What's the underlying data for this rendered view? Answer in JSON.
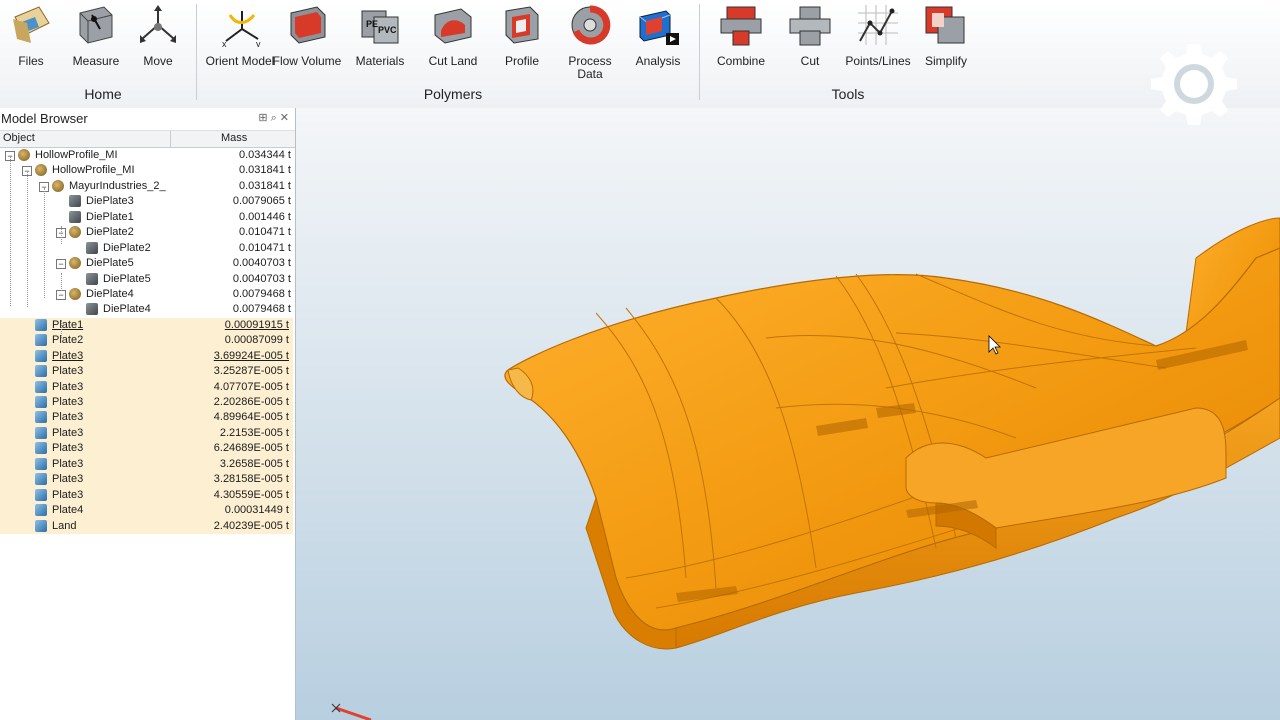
{
  "ribbon": {
    "buttons": [
      {
        "label": "Files",
        "icon": "files-icon"
      },
      {
        "label": "Measure",
        "icon": "measure-icon"
      },
      {
        "label": "Move",
        "icon": "move-icon"
      },
      {
        "label": "Orient Model",
        "icon": "orient-model-icon"
      },
      {
        "label": "Flow Volume",
        "icon": "flow-volume-icon"
      },
      {
        "label": "Materials",
        "icon": "materials-icon"
      },
      {
        "label": "Cut Land",
        "icon": "cut-land-icon"
      },
      {
        "label": "Profile",
        "icon": "profile-icon"
      },
      {
        "label": "Process\nData",
        "icon": "process-data-icon"
      },
      {
        "label": "Analysis",
        "icon": "analysis-icon"
      },
      {
        "label": "Combine",
        "icon": "combine-icon"
      },
      {
        "label": "Cut",
        "icon": "cut-icon"
      },
      {
        "label": "Points/Lines",
        "icon": "points-lines-icon"
      },
      {
        "label": "Simplify",
        "icon": "simplify-icon"
      }
    ],
    "groups": {
      "home": "Home",
      "polymers": "Polymers",
      "tools": "Tools"
    },
    "materials_icon_text": {
      "a": "PE",
      "b": "PVC"
    }
  },
  "model_browser": {
    "title": "Model Browser",
    "col_object": "Object",
    "col_mass": "Mass",
    "rows": [
      {
        "name": "HollowProfile_MI",
        "mass": "0.034344 t"
      },
      {
        "name": "HollowProfile_MI",
        "mass": "0.031841 t"
      },
      {
        "name": "MayurIndustries_2_",
        "mass": "0.031841 t"
      },
      {
        "name": "DiePlate3",
        "mass": "0.0079065 t"
      },
      {
        "name": "DiePlate1",
        "mass": "0.001446 t"
      },
      {
        "name": "DiePlate2",
        "mass": "0.010471 t"
      },
      {
        "name": "DiePlate2",
        "mass": "0.010471 t"
      },
      {
        "name": "DiePlate5",
        "mass": "0.0040703 t"
      },
      {
        "name": "DiePlate5",
        "mass": "0.0040703 t"
      },
      {
        "name": "DiePlate4",
        "mass": "0.0079468 t"
      },
      {
        "name": "DiePlate4",
        "mass": "0.0079468 t"
      },
      {
        "name": "Plate1",
        "mass": "0.00091915 t"
      },
      {
        "name": "Plate2",
        "mass": "0.00087099 t"
      },
      {
        "name": "Plate3",
        "mass": "3.69924E-005 t"
      },
      {
        "name": "Plate3",
        "mass": "3.25287E-005 t"
      },
      {
        "name": "Plate3",
        "mass": "4.07707E-005 t"
      },
      {
        "name": "Plate3",
        "mass": "2.20286E-005 t"
      },
      {
        "name": "Plate3",
        "mass": "4.89964E-005 t"
      },
      {
        "name": "Plate3",
        "mass": "2.2153E-005 t"
      },
      {
        "name": "Plate3",
        "mass": "6.24689E-005 t"
      },
      {
        "name": "Plate3",
        "mass": "3.2658E-005 t"
      },
      {
        "name": "Plate3",
        "mass": "3.28158E-005 t"
      },
      {
        "name": "Plate3",
        "mass": "4.30559E-005 t"
      },
      {
        "name": "Plate4",
        "mass": "0.00031449 t"
      },
      {
        "name": "Land",
        "mass": "2.40239E-005 t"
      }
    ]
  },
  "colors": {
    "part": "#f39b12",
    "part_edge": "#b86a00",
    "viewport_top": "#f4f6f8",
    "viewport_bottom": "#b8cfe0",
    "highlight": "#fdf0d2"
  }
}
